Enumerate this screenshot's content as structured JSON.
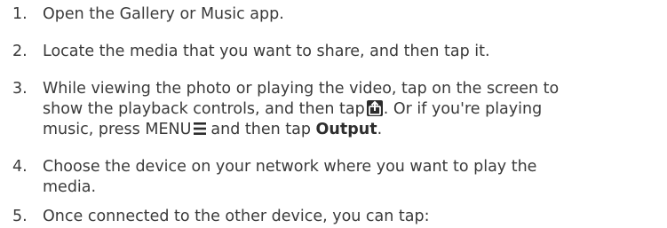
{
  "steps": [
    {
      "number": "1.",
      "text": "Open the Gallery or Music app."
    },
    {
      "number": "2.",
      "text": "Locate the media that you want to share, and then tap it."
    },
    {
      "number": "3.",
      "line1": "While viewing the photo or playing the video, tap on the screen to",
      "line2a": "show the playback controls, and then tap",
      "share_icon": "output-device-icon",
      "line2b": ". Or if you're playing",
      "line3a": "music, press MENU",
      "menu_icon": "menu-icon",
      "line3b": "and then tap",
      "bold": "Output",
      "line3c": "."
    },
    {
      "number": "4.",
      "line1": "Choose the device on your network where you want to play the",
      "line2": "media."
    },
    {
      "number": "5.",
      "text": "Once connected to the other device, you can tap:"
    }
  ]
}
